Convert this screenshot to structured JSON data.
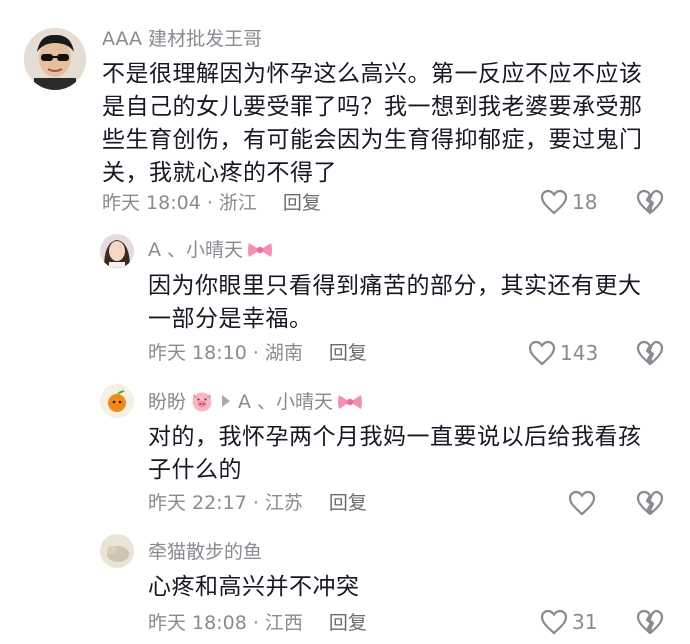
{
  "comments": [
    {
      "username": "AAA 建材批发王哥",
      "text": "不是很理解因为怀孕这么高兴。第一反应不应不应该是自己的女儿要受罪了吗？我一想到我老婆要承受那些生育创伤，有可能会因为生育得抑郁症，要过鬼门关，我就心疼的不得了",
      "time_location": "昨天 18:04 · 浙江",
      "reply_label": "回复",
      "likes": "18"
    },
    {
      "username": "A 、小晴天",
      "text": "因为你眼里只看得到痛苦的部分，其实还有更大一部分是幸福。",
      "time_location": "昨天 18:10 · 湖南",
      "reply_label": "回复",
      "likes": "143"
    },
    {
      "username": "盼盼",
      "reply_to": "A 、小晴天",
      "text": "对的，我怀孕两个月我妈一直要说以后给我看孩子什么的",
      "time_location": "昨天 22:17 · 江苏",
      "reply_label": "回复",
      "likes": ""
    },
    {
      "username": "牵猫散步的鱼",
      "text": "心疼和高兴并不冲突",
      "time_location": "昨天 18:08 · 江西",
      "reply_label": "回复",
      "likes": "31"
    }
  ],
  "colors": {
    "text_primary": "#161823",
    "text_secondary": "#8a8b91",
    "bow_pink": "#f48fb1"
  },
  "icons": {
    "like": "heart-outline-icon",
    "dislike": "broken-heart-icon",
    "reply_arrow": "reply-arrow-icon",
    "bow": "pink-bow-icon",
    "pig": "pig-face-icon"
  }
}
